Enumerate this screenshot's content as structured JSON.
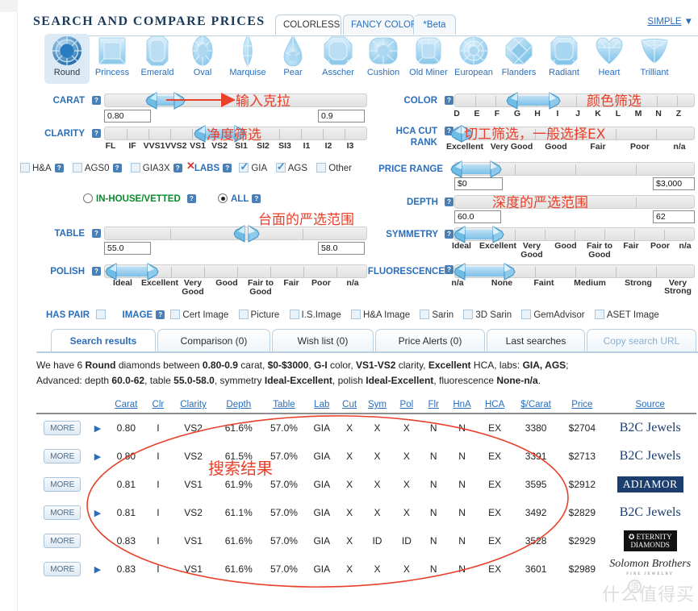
{
  "header": {
    "title": "SEARCH AND COMPARE PRICES",
    "tabs": [
      {
        "label": "COLORLESS",
        "active": true
      },
      {
        "label": "FANCY COLOR",
        "active": false
      },
      {
        "label": "*Beta",
        "active": false
      }
    ],
    "simple_link": "SIMPLE",
    "simple_caret": "▼"
  },
  "shapes": [
    {
      "label": "Round",
      "icon": "round-gem-icon",
      "selected": true
    },
    {
      "label": "Princess",
      "icon": "princess-gem-icon",
      "selected": false
    },
    {
      "label": "Emerald",
      "icon": "emerald-gem-icon",
      "selected": false
    },
    {
      "label": "Oval",
      "icon": "oval-gem-icon",
      "selected": false
    },
    {
      "label": "Marquise",
      "icon": "marquise-gem-icon",
      "selected": false
    },
    {
      "label": "Pear",
      "icon": "pear-gem-icon",
      "selected": false
    },
    {
      "label": "Asscher",
      "icon": "asscher-gem-icon",
      "selected": false
    },
    {
      "label": "Cushion",
      "icon": "cushion-gem-icon",
      "selected": false
    },
    {
      "label": "Old Miner",
      "icon": "old-miner-gem-icon",
      "selected": false
    },
    {
      "label": "European",
      "icon": "european-gem-icon",
      "selected": false
    },
    {
      "label": "Flanders",
      "icon": "flanders-gem-icon",
      "selected": false
    },
    {
      "label": "Radiant",
      "icon": "radiant-gem-icon",
      "selected": false
    },
    {
      "label": "Heart",
      "icon": "heart-gem-icon",
      "selected": false
    },
    {
      "label": "Trilliant",
      "icon": "trilliant-gem-icon",
      "selected": false
    }
  ],
  "filters": {
    "carat": {
      "label": "CARAT",
      "min_value": "0.80",
      "max_value": "0.9"
    },
    "clarity": {
      "label": "CLARITY",
      "scale": [
        "FL",
        "IF",
        "VVS1",
        "VVS2",
        "VS1",
        "VS2",
        "SI1",
        "SI2",
        "SI3",
        "I1",
        "I2",
        "I3"
      ],
      "selected_from": "VS1",
      "selected_to": "VS2"
    },
    "color": {
      "label": "COLOR",
      "scale": [
        "D",
        "E",
        "F",
        "G",
        "H",
        "I",
        "J",
        "K",
        "L",
        "M",
        "N",
        "Z"
      ],
      "selected_from": "G",
      "selected_to": "I"
    },
    "hca_cut_rank": {
      "label_line1": "HCA CUT",
      "label_line2": "RANK",
      "scale": [
        "Excellent",
        "Very Good",
        "Good",
        "Fair",
        "Poor",
        "n/a"
      ],
      "selected_from": "Excellent",
      "selected_to": "Excellent"
    },
    "price_range": {
      "label": "PRICE RANGE",
      "min_value": "$0",
      "max_value": "$3,000"
    },
    "depth": {
      "label": "DEPTH",
      "min_value": "60.0",
      "max_value": "62"
    },
    "table": {
      "label": "TABLE",
      "min_value": "55.0",
      "max_value": "58.0"
    },
    "symmetry": {
      "label": "SYMMETRY",
      "scale": [
        "Ideal",
        "Excellent",
        "Very Good",
        "Good",
        "Fair to Good",
        "Fair",
        "Poor",
        "n/a"
      ],
      "selected_from": "Ideal",
      "selected_to": "Excellent"
    },
    "polish": {
      "label": "POLISH",
      "scale": [
        "Ideal",
        "Excellent",
        "Very Good",
        "Good",
        "Fair to Good",
        "Fair",
        "Poor",
        "n/a"
      ],
      "selected_from": "Ideal",
      "selected_to": "Excellent"
    },
    "fluorescence": {
      "label": "FLUORESCENCE",
      "scale": [
        "n/a",
        "None",
        "Faint",
        "Medium",
        "Strong",
        "Very Strong"
      ],
      "selected_from": "n/a",
      "selected_to": "None"
    }
  },
  "cert_row": {
    "ha": {
      "label": "H&A",
      "checked": false
    },
    "ags0": {
      "label": "AGS0",
      "checked": false
    },
    "gia3x": {
      "label": "GIA3X",
      "checked": false,
      "marked_x": true
    },
    "labs_label": "LABS",
    "gia": {
      "label": "GIA",
      "checked": true
    },
    "ags": {
      "label": "AGS",
      "checked": true
    },
    "other": {
      "label": "Other",
      "checked": false
    }
  },
  "vetted_row": {
    "in_house": {
      "label": "IN-HOUSE/VETTED",
      "selected": false
    },
    "all": {
      "label": "ALL",
      "selected": true
    }
  },
  "image_row": {
    "has_pair_label": "HAS PAIR",
    "has_pair_checked": false,
    "image_label": "IMAGE",
    "options": [
      {
        "label": "Cert Image",
        "checked": false
      },
      {
        "label": "Picture",
        "checked": false
      },
      {
        "label": "I.S.Image",
        "checked": false
      },
      {
        "label": "H&A Image",
        "checked": false
      },
      {
        "label": "Sarin",
        "checked": false
      },
      {
        "label": "3D Sarin",
        "checked": false
      },
      {
        "label": "GemAdvisor",
        "checked": false
      },
      {
        "label": "ASET Image",
        "checked": false
      }
    ]
  },
  "result_tabs": [
    {
      "label": "Search results",
      "active": true,
      "dim": false
    },
    {
      "label": "Comparison (0)",
      "active": false,
      "dim": false
    },
    {
      "label": "Wish list (0)",
      "active": false,
      "dim": false
    },
    {
      "label": "Price Alerts (0)",
      "active": false,
      "dim": false
    },
    {
      "label": "Last searches",
      "active": false,
      "dim": false
    },
    {
      "label": "Copy search URL",
      "active": false,
      "dim": true
    }
  ],
  "summary": {
    "line1_pre": "We have 6 ",
    "line1_shape": "Round",
    "line1_mid1": " diamonds between ",
    "line1_carat": "0.80-0.9",
    "line1_mid2": " carat, ",
    "line1_price": "$0-$3000",
    "line1_mid3": ", ",
    "line1_color": "G-I",
    "line1_mid4": " color, ",
    "line1_clarity": "VS1-VS2",
    "line1_mid5": " clarity, ",
    "line1_hca": "Excellent",
    "line1_mid6": " HCA, labs: ",
    "line1_labs": "GIA, AGS",
    "line1_end": ";",
    "line2_pre": "Advanced: depth ",
    "line2_depth": "60.0-62",
    "line2_mid1": ", table ",
    "line2_table": "55.0-58.0",
    "line2_mid2": ", symmetry ",
    "line2_sym": "Ideal-Excellent",
    "line2_mid3": ", polish ",
    "line2_pol": "Ideal-Excellent",
    "line2_mid4": ", fluorescence ",
    "line2_flr": "None-n/a",
    "line2_end": "."
  },
  "table": {
    "more_label": "MORE",
    "columns": [
      "Carat",
      "Clr",
      "Clarity",
      "Depth",
      "Table",
      "Lab",
      "Cut",
      "Sym",
      "Pol",
      "Flr",
      "HnA",
      "HCA",
      "$/Carat",
      "Price",
      "Source"
    ],
    "rows": [
      {
        "expand": true,
        "carat": "0.80",
        "clr": "I",
        "clarity": "VS2",
        "depth": "61.6%",
        "table": "57.0%",
        "lab": "GIA",
        "cut": "X",
        "sym": "X",
        "pol": "X",
        "flr": "N",
        "hna": "N",
        "hca": "EX",
        "per_carat": "3380",
        "price": "$2704",
        "source": "B2C Jewels",
        "source_style": "plain"
      },
      {
        "expand": true,
        "carat": "0.80",
        "clr": "I",
        "clarity": "VS2",
        "depth": "61.5%",
        "table": "57.0%",
        "lab": "GIA",
        "cut": "X",
        "sym": "X",
        "pol": "X",
        "flr": "N",
        "hna": "N",
        "hca": "EX",
        "per_carat": "3391",
        "price": "$2713",
        "source": "B2C Jewels",
        "source_style": "plain"
      },
      {
        "expand": false,
        "carat": "0.81",
        "clr": "I",
        "clarity": "VS1",
        "depth": "61.9%",
        "table": "57.0%",
        "lab": "GIA",
        "cut": "X",
        "sym": "X",
        "pol": "X",
        "flr": "N",
        "hna": "N",
        "hca": "EX",
        "per_carat": "3595",
        "price": "$2912",
        "source": "ADIAMOR",
        "source_style": "adiamor"
      },
      {
        "expand": true,
        "carat": "0.81",
        "clr": "I",
        "clarity": "VS2",
        "depth": "61.1%",
        "table": "57.0%",
        "lab": "GIA",
        "cut": "X",
        "sym": "X",
        "pol": "X",
        "flr": "N",
        "hna": "N",
        "hca": "EX",
        "per_carat": "3492",
        "price": "$2829",
        "source": "B2C Jewels",
        "source_style": "plain"
      },
      {
        "expand": false,
        "carat": "0.83",
        "clr": "I",
        "clarity": "VS1",
        "depth": "61.6%",
        "table": "57.0%",
        "lab": "GIA",
        "cut": "X",
        "sym": "ID",
        "pol": "ID",
        "flr": "N",
        "hna": "N",
        "hca": "EX",
        "per_carat": "3528",
        "price": "$2929",
        "source": "ETERNITY DIAMONDS",
        "source_style": "eternity"
      },
      {
        "expand": true,
        "carat": "0.83",
        "clr": "I",
        "clarity": "VS1",
        "depth": "61.6%",
        "table": "57.0%",
        "lab": "GIA",
        "cut": "X",
        "sym": "X",
        "pol": "X",
        "flr": "N",
        "hna": "N",
        "hca": "EX",
        "per_carat": "3601",
        "price": "$2989",
        "source": "Solomon Brothers",
        "source_style": "solomon"
      }
    ]
  },
  "annotations": [
    {
      "text": "输入克拉",
      "name": "anno-enter-carat"
    },
    {
      "text": "净度筛选",
      "name": "anno-clarity-filter"
    },
    {
      "text": "颜色筛选",
      "name": "anno-color-filter"
    },
    {
      "text": "切工筛选，一般选择EX",
      "name": "anno-cut-filter"
    },
    {
      "text": "深度的严选范围",
      "name": "anno-depth-range"
    },
    {
      "text": "台面的严选范围",
      "name": "anno-table-range"
    },
    {
      "text": "搜索结果",
      "name": "anno-search-results"
    }
  ],
  "watermark": {
    "text": "什么值得买",
    "mark": "值"
  },
  "colors": {
    "accent_blue": "#2a6ebb",
    "anno_red": "#e8402a",
    "slider_fill": "#7cc0e8",
    "source_navy": "#1b3e6f"
  }
}
